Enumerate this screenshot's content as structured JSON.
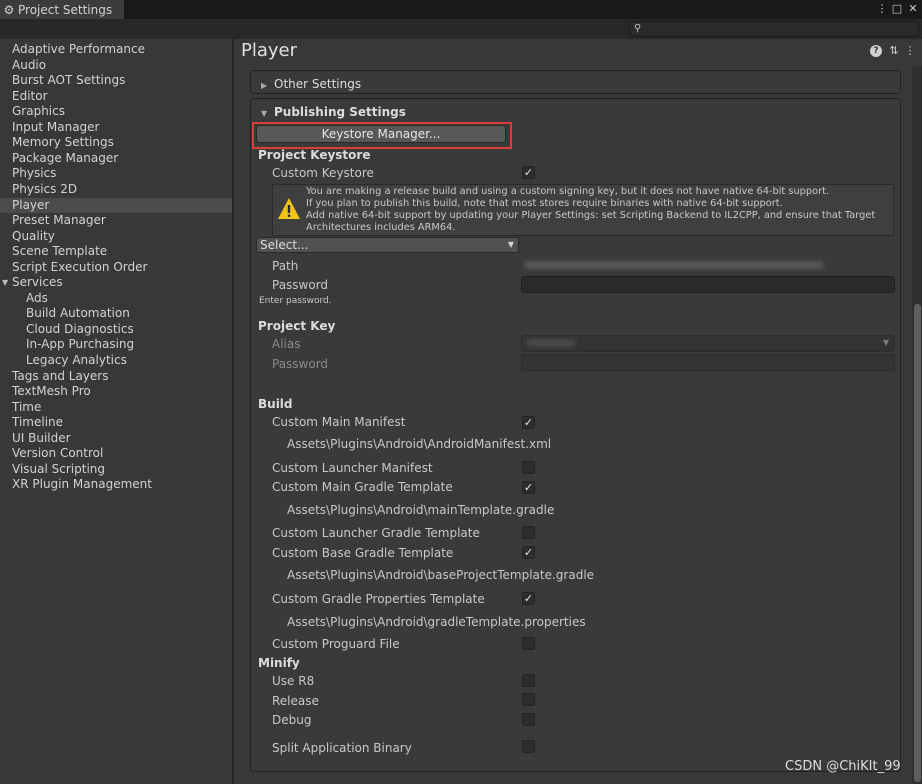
{
  "window": {
    "tab_title": "Project Settings",
    "controls": [
      "⋮",
      "□",
      "✕"
    ]
  },
  "search": {
    "placeholder": ""
  },
  "sidebar": {
    "items": [
      {
        "label": "Adaptive Performance"
      },
      {
        "label": "Audio"
      },
      {
        "label": "Burst AOT Settings"
      },
      {
        "label": "Editor"
      },
      {
        "label": "Graphics"
      },
      {
        "label": "Input Manager"
      },
      {
        "label": "Memory Settings"
      },
      {
        "label": "Package Manager"
      },
      {
        "label": "Physics"
      },
      {
        "label": "Physics 2D"
      },
      {
        "label": "Player",
        "selected": true
      },
      {
        "label": "Preset Manager"
      },
      {
        "label": "Quality"
      },
      {
        "label": "Scene Template"
      },
      {
        "label": "Script Execution Order"
      },
      {
        "label": "Services",
        "expanded": true
      },
      {
        "label": "Ads",
        "child": true
      },
      {
        "label": "Build Automation",
        "child": true
      },
      {
        "label": "Cloud Diagnostics",
        "child": true
      },
      {
        "label": "In-App Purchasing",
        "child": true
      },
      {
        "label": "Legacy Analytics",
        "child": true
      },
      {
        "label": "Tags and Layers"
      },
      {
        "label": "TextMesh Pro"
      },
      {
        "label": "Time"
      },
      {
        "label": "Timeline"
      },
      {
        "label": "UI Builder"
      },
      {
        "label": "Version Control"
      },
      {
        "label": "Visual Scripting"
      },
      {
        "label": "XR Plugin Management"
      }
    ]
  },
  "main": {
    "title": "Player",
    "other_settings": "Other Settings",
    "publishing_settings": "Publishing Settings",
    "keystore_button": "Keystore Manager...",
    "project_keystore": {
      "heading": "Project Keystore",
      "custom_keystore_label": "Custom Keystore",
      "custom_keystore_checked": true,
      "warning_lines": [
        "You are making a release build and using a custom signing key, but it does not have native 64-bit support.",
        "If you plan to publish this build, note that most stores require binaries with native 64-bit support.",
        "Add native 64-bit support by updating your Player Settings: set Scripting Backend to IL2CPP, and ensure that Target",
        "Architectures includes ARM64."
      ],
      "select_value": "Select...",
      "path_label": "Path",
      "password_label": "Password",
      "password_hint": "Enter password."
    },
    "project_key": {
      "heading": "Project Key",
      "alias_label": "Alias",
      "password_label": "Password"
    },
    "build": {
      "heading": "Build",
      "rows": [
        {
          "label": "Custom Main Manifest",
          "checked": true,
          "path": "Assets\\Plugins\\Android\\AndroidManifest.xml"
        },
        {
          "label": "Custom Launcher Manifest",
          "checked": false
        },
        {
          "label": "Custom Main Gradle Template",
          "checked": true,
          "path": "Assets\\Plugins\\Android\\mainTemplate.gradle"
        },
        {
          "label": "Custom Launcher Gradle Template",
          "checked": false
        },
        {
          "label": "Custom Base Gradle Template",
          "checked": true,
          "path": "Assets\\Plugins\\Android\\baseProjectTemplate.gradle"
        },
        {
          "label": "Custom Gradle Properties Template",
          "checked": true,
          "path": "Assets\\Plugins\\Android\\gradleTemplate.properties"
        },
        {
          "label": "Custom Proguard File",
          "checked": false
        }
      ]
    },
    "minify": {
      "heading": "Minify",
      "rows": [
        {
          "label": "Use R8",
          "checked": false
        },
        {
          "label": "Release",
          "checked": false
        },
        {
          "label": "Debug",
          "checked": false
        }
      ]
    },
    "split_binary": {
      "label": "Split Application Binary",
      "checked": false
    }
  },
  "watermark": "CSDN @ChiKIt_99",
  "colors": {
    "highlight": "#e03a3a",
    "warning": "#f0c419"
  }
}
